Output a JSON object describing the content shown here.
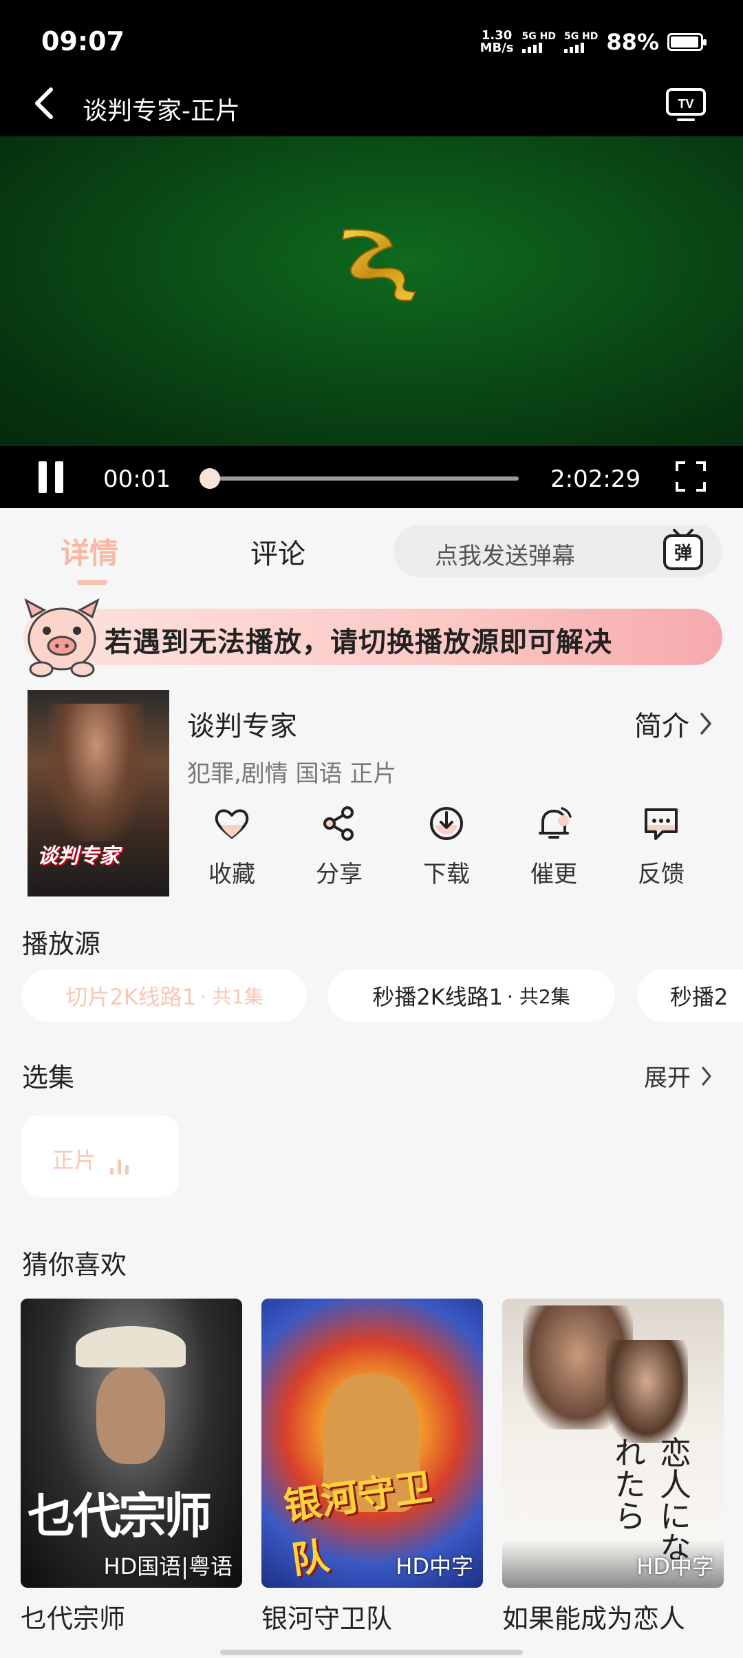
{
  "status_bar": {
    "time": "09:07",
    "net_speed_value": "1.30",
    "net_speed_unit": "MB/s",
    "signal_1": "5G HD",
    "signal_2": "5G HD",
    "battery": "88%"
  },
  "header": {
    "title": "谈判专家-正片"
  },
  "player": {
    "current_time": "00:01",
    "total_time": "2:02:29",
    "progress": 0.0
  },
  "tabs": {
    "detail": "详情",
    "comments": "评论"
  },
  "danmaku": {
    "placeholder": "点我发送弹幕",
    "button": "弹"
  },
  "notice": {
    "text": "若遇到无法播放，请切换播放源即可解决"
  },
  "movie": {
    "poster_title": "谈判专家",
    "title": "谈判专家",
    "intro": "简介",
    "meta": "犯罪,剧情 国语 正片"
  },
  "actions": [
    {
      "label": "收藏",
      "icon": "heart-icon"
    },
    {
      "label": "分享",
      "icon": "share-icon"
    },
    {
      "label": "下载",
      "icon": "download-icon"
    },
    {
      "label": "催更",
      "icon": "bell-icon"
    },
    {
      "label": "反馈",
      "icon": "feedback-icon"
    }
  ],
  "sources": {
    "heading": "播放源",
    "items": [
      {
        "name": "切片2K线路1",
        "count": "· 共1集"
      },
      {
        "name": "秒播2K线路1",
        "count": "· 共2集"
      },
      {
        "name": "秒播2",
        "count": ""
      }
    ]
  },
  "episodes": {
    "heading": "选集",
    "expand": "展开",
    "items": [
      {
        "label": "正片"
      }
    ]
  },
  "recommendations": {
    "heading": "猜你喜欢",
    "items": [
      {
        "title": "乜代宗师",
        "badge": "HD国语|粤语"
      },
      {
        "title": "银河守卫队",
        "badge": "HD中字"
      },
      {
        "title": "如果能成为恋人",
        "badge": "HD中字"
      }
    ]
  },
  "colors": {
    "accent": "#f7b9a6",
    "notice_gradient_end": "#f6a9ae",
    "video_green": "#0b4f17"
  }
}
